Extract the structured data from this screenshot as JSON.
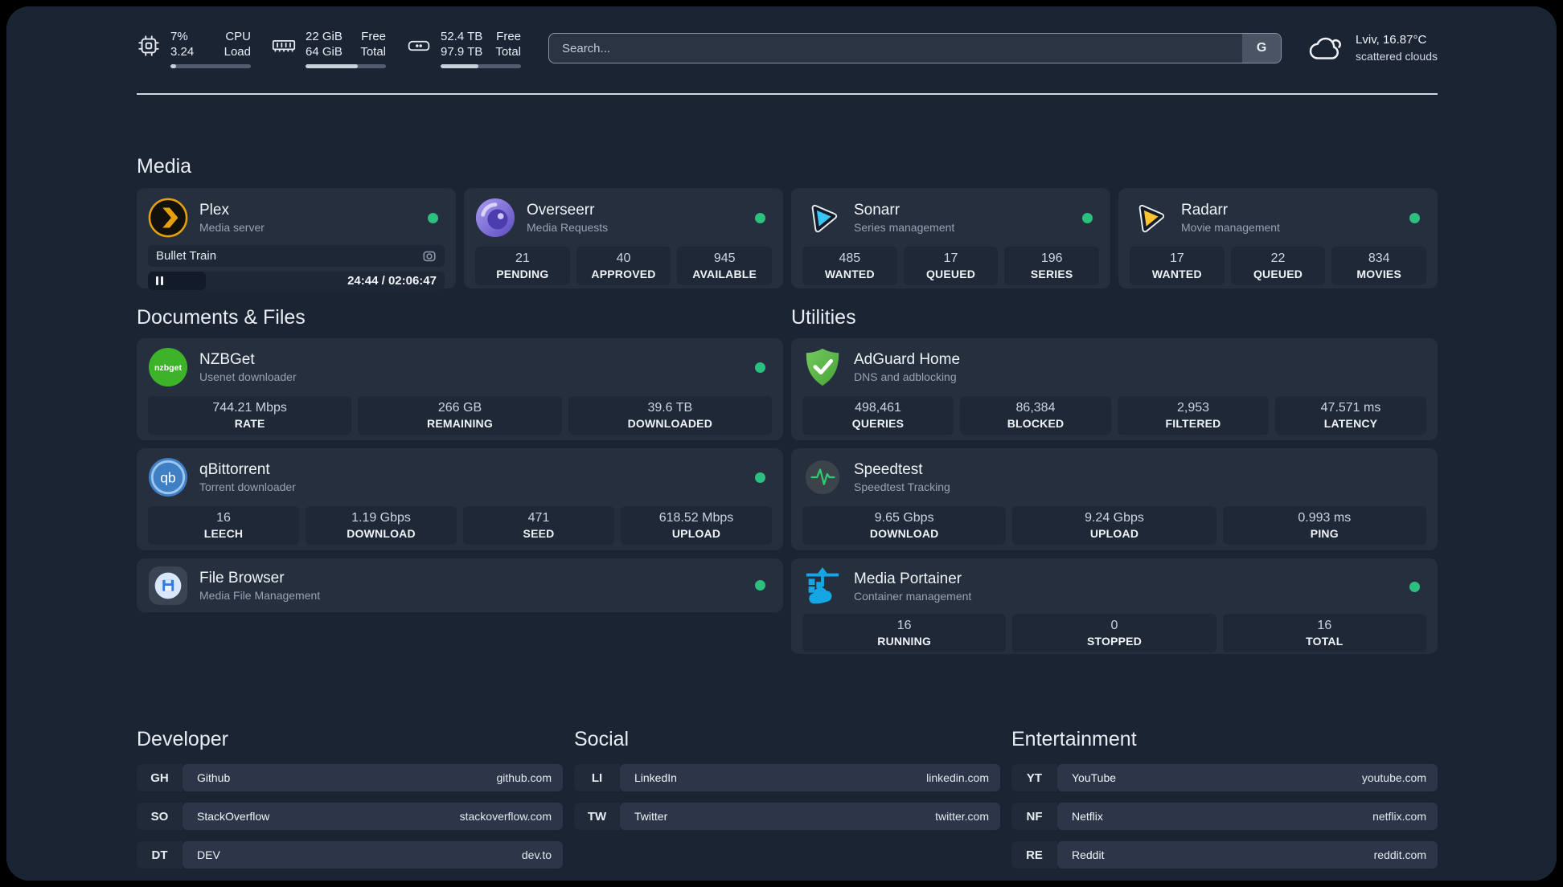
{
  "topbar": {
    "cpu": {
      "line1": "7%",
      "line2": "3.24",
      "label1": "CPU",
      "label2": "Load",
      "bar_style": "width:7%"
    },
    "ram": {
      "line1": "22 GiB",
      "line2": "64 GiB",
      "label1": "Free",
      "label2": "Total",
      "bar_style": "width:65%"
    },
    "disk": {
      "line1": "52.4 TB",
      "line2": "97.9 TB",
      "label1": "Free",
      "label2": "Total",
      "bar_style": "width:47%"
    },
    "search": {
      "placeholder": "Search...",
      "engine_button": "G"
    },
    "weather": {
      "location": "Lviv, 16.87°C",
      "condition": "scattered clouds"
    }
  },
  "sections": {
    "media": "Media",
    "documents": "Documents & Files",
    "utilities": "Utilities",
    "developer": "Developer",
    "social": "Social",
    "entertainment": "Entertainment"
  },
  "cards": {
    "plex": {
      "name": "Plex",
      "desc": "Media server",
      "now_playing": "Bullet Train",
      "time": "24:44 / 02:06:47",
      "progress_style": "width:19.5%"
    },
    "overseerr": {
      "name": "Overseerr",
      "desc": "Media Requests",
      "stats": [
        {
          "value": "21",
          "label": "PENDING"
        },
        {
          "value": "40",
          "label": "APPROVED"
        },
        {
          "value": "945",
          "label": "AVAILABLE"
        }
      ]
    },
    "sonarr": {
      "name": "Sonarr",
      "desc": "Series management",
      "stats": [
        {
          "value": "485",
          "label": "WANTED"
        },
        {
          "value": "17",
          "label": "QUEUED"
        },
        {
          "value": "196",
          "label": "SERIES"
        }
      ]
    },
    "radarr": {
      "name": "Radarr",
      "desc": "Movie management",
      "stats": [
        {
          "value": "17",
          "label": "WANTED"
        },
        {
          "value": "22",
          "label": "QUEUED"
        },
        {
          "value": "834",
          "label": "MOVIES"
        }
      ]
    },
    "nzbget": {
      "name": "NZBGet",
      "desc": "Usenet downloader",
      "icon_text": "nzbget",
      "stats": [
        {
          "value": "744.21 Mbps",
          "label": "RATE"
        },
        {
          "value": "266 GB",
          "label": "REMAINING"
        },
        {
          "value": "39.6 TB",
          "label": "DOWNLOADED"
        }
      ]
    },
    "qbittorrent": {
      "name": "qBittorrent",
      "desc": "Torrent downloader",
      "icon_text": "qb",
      "stats": [
        {
          "value": "16",
          "label": "LEECH"
        },
        {
          "value": "1.19 Gbps",
          "label": "DOWNLOAD"
        },
        {
          "value": "471",
          "label": "SEED"
        },
        {
          "value": "618.52 Mbps",
          "label": "UPLOAD"
        }
      ]
    },
    "filebrowser": {
      "name": "File Browser",
      "desc": "Media File Management"
    },
    "adguard": {
      "name": "AdGuard Home",
      "desc": "DNS and adblocking",
      "stats": [
        {
          "value": "498,461",
          "label": "QUERIES"
        },
        {
          "value": "86,384",
          "label": "BLOCKED"
        },
        {
          "value": "2,953",
          "label": "FILTERED"
        },
        {
          "value": "47.571 ms",
          "label": "LATENCY"
        }
      ]
    },
    "speedtest": {
      "name": "Speedtest",
      "desc": "Speedtest Tracking",
      "stats": [
        {
          "value": "9.65 Gbps",
          "label": "DOWNLOAD"
        },
        {
          "value": "9.24 Gbps",
          "label": "UPLOAD"
        },
        {
          "value": "0.993 ms",
          "label": "PING"
        }
      ]
    },
    "portainer": {
      "name": "Media Portainer",
      "desc": "Container management",
      "stats": [
        {
          "value": "16",
          "label": "RUNNING"
        },
        {
          "value": "0",
          "label": "STOPPED"
        },
        {
          "value": "16",
          "label": "TOTAL"
        }
      ]
    }
  },
  "links": {
    "developer": [
      {
        "abbr": "GH",
        "name": "Github",
        "url": "github.com"
      },
      {
        "abbr": "SO",
        "name": "StackOverflow",
        "url": "stackoverflow.com"
      },
      {
        "abbr": "DT",
        "name": "DEV",
        "url": "dev.to"
      }
    ],
    "social": [
      {
        "abbr": "LI",
        "name": "LinkedIn",
        "url": "linkedin.com"
      },
      {
        "abbr": "TW",
        "name": "Twitter",
        "url": "twitter.com"
      }
    ],
    "entertainment": [
      {
        "abbr": "YT",
        "name": "YouTube",
        "url": "youtube.com"
      },
      {
        "abbr": "NF",
        "name": "Netflix",
        "url": "netflix.com"
      },
      {
        "abbr": "RE",
        "name": "Reddit",
        "url": "reddit.com"
      }
    ]
  },
  "colors": {
    "status_online": "#2bc07d",
    "accent_plex": "#e5a00d",
    "accent_sonarr": "#38c6f4",
    "accent_radarr": "#ffc230",
    "accent_nzbget": "#3db32a",
    "accent_qbittorrent": "#3f7fc4",
    "accent_adguard": "#5cb54a",
    "accent_portainer": "#15a7e5"
  }
}
